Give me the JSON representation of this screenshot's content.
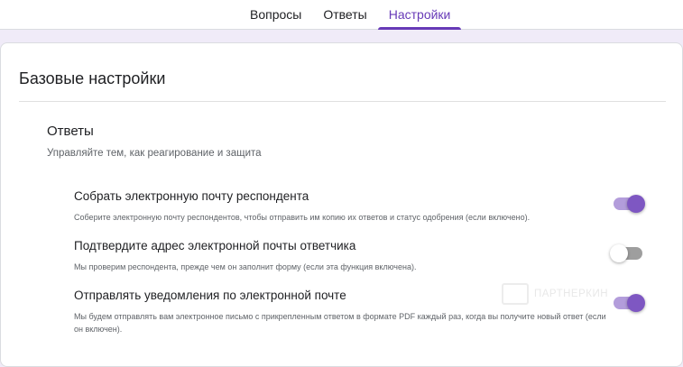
{
  "tabs": [
    {
      "label": "Вопросы",
      "active": false
    },
    {
      "label": "Ответы",
      "active": false
    },
    {
      "label": "Настройки",
      "active": true
    }
  ],
  "card": {
    "title": "Базовые настройки",
    "section": {
      "title": "Ответы",
      "subtitle": "Управляйте тем, как реагирование и защита"
    },
    "settings": [
      {
        "label": "Собрать электронную почту респондента",
        "description": "Соберите электронную почту респондентов, чтобы отправить им копию их ответов и статус одобрения (если включено).",
        "enabled": true
      },
      {
        "label": "Подтвердите адрес электронной почты ответчика",
        "description": "Мы проверим респондента, прежде чем он заполнит форму (если эта функция включена).",
        "enabled": false
      },
      {
        "label": "Отправлять уведомления по электронной почте",
        "description": "Мы будем отправлять вам электронное письмо с прикрепленным ответом в формате PDF каждый раз, когда вы получите новый ответ (если он включен).",
        "enabled": true
      }
    ]
  },
  "watermark": {
    "text": "ПАРТНЕРКИН"
  },
  "colors": {
    "accent": "#673ab7",
    "toggle_on_track": "#b39ddb",
    "toggle_on_thumb": "#7e57c2",
    "page_bg": "#f0ebf8"
  }
}
